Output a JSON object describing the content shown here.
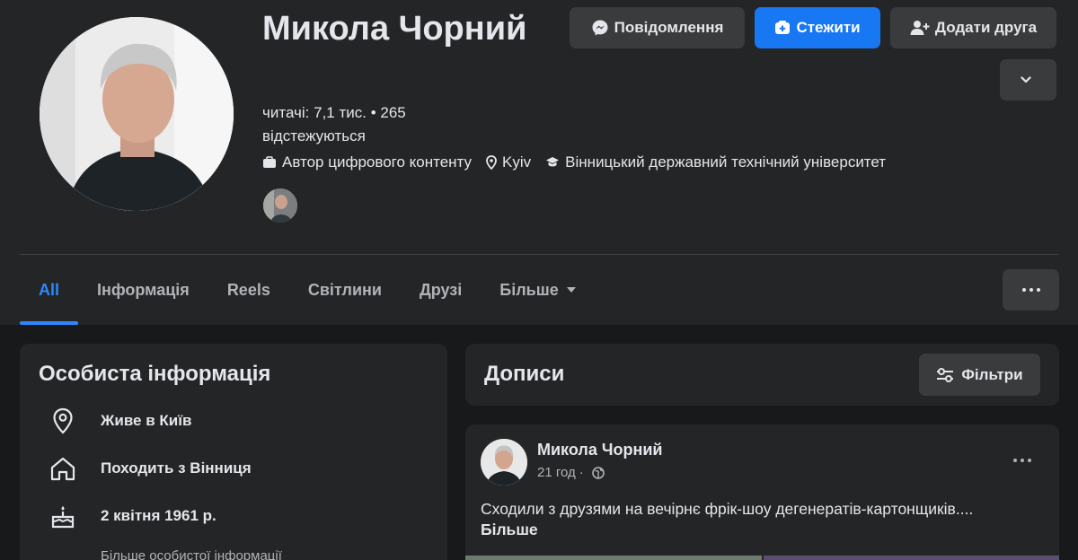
{
  "profile": {
    "name": "Микола Чорний",
    "stats": "читачі: 7,1 тис. • 265 відстежуються",
    "meta": [
      {
        "icon": "briefcase-icon",
        "label": "Автор цифрового контенту"
      },
      {
        "icon": "location-pin-icon",
        "label": "Kyiv"
      },
      {
        "icon": "graduation-cap-icon",
        "label": "Вінницький державний технічний університет"
      }
    ]
  },
  "actions": {
    "message": "Повідомлення",
    "follow": "Стежити",
    "add_friend": "Додати друга"
  },
  "tabs": [
    {
      "label": "All",
      "active": true
    },
    {
      "label": "Інформація"
    },
    {
      "label": "Reels"
    },
    {
      "label": "Світлини"
    },
    {
      "label": "Друзі"
    },
    {
      "label": "Більше"
    }
  ],
  "about": {
    "title": "Особиста інформація",
    "rows": [
      {
        "icon": "location-pin-icon",
        "text": "Живе в Київ"
      },
      {
        "icon": "home-icon",
        "text": "Походить з Вінниця"
      },
      {
        "icon": "birthday-cake-icon",
        "text": "2 квітня 1961 р."
      }
    ],
    "more": "Більше особистої інформації"
  },
  "posts": {
    "title": "Дописи",
    "filters": "Фільтри",
    "post": {
      "author": "Микола Чорний",
      "time": "21 год",
      "text": "Сходили з друзями на вечірнє фрік-шоу дегенератів-картонщиків....",
      "more": "Більше"
    }
  },
  "colors": {
    "accent": "#2d88ff",
    "follow_button": "#1877f2",
    "background": "#18191a",
    "surface": "#242526"
  }
}
